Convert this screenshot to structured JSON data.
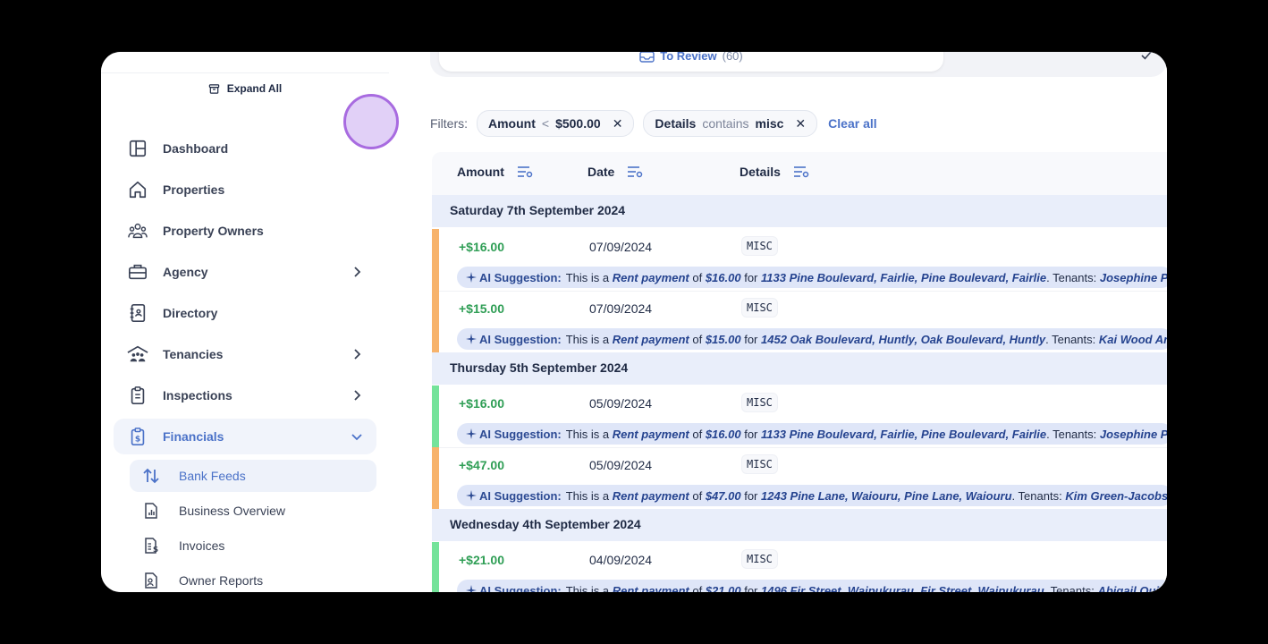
{
  "sidebar": {
    "expand_all": "Expand All",
    "items": [
      {
        "label": "Dashboard",
        "icon": "dashboard-icon"
      },
      {
        "label": "Properties",
        "icon": "home-icon"
      },
      {
        "label": "Property Owners",
        "icon": "people-icon"
      },
      {
        "label": "Agency",
        "icon": "briefcase-icon"
      },
      {
        "label": "Directory",
        "icon": "contacts-book-icon"
      },
      {
        "label": "Tenancies",
        "icon": "tenants-icon"
      },
      {
        "label": "Inspections",
        "icon": "clipboard-icon"
      },
      {
        "label": "Financials",
        "icon": "money-clipboard-icon"
      }
    ],
    "sub_items": [
      {
        "label": "Bank Feeds",
        "icon": "arrows-updown-icon"
      },
      {
        "label": "Business Overview",
        "icon": "report-chart-icon"
      },
      {
        "label": "Invoices",
        "icon": "invoice-icon"
      },
      {
        "label": "Owner Reports",
        "icon": "owner-report-icon"
      }
    ]
  },
  "tabs": {
    "review_label": "To Review",
    "review_count": "(60)"
  },
  "filters": {
    "label": "Filters:",
    "chips": [
      {
        "key": "Amount",
        "op": "<",
        "value": "$500.00"
      },
      {
        "key": "Details",
        "op": "contains",
        "value": "misc"
      }
    ],
    "clear_all": "Clear all"
  },
  "table": {
    "columns": [
      "Amount",
      "Date",
      "Details"
    ],
    "groups": [
      {
        "label": "Saturday 7th September 2024",
        "rows": [
          {
            "amount": "+$16.00",
            "date": "07/09/2024",
            "details": "MISC",
            "bar_color": "#f7b36b",
            "suggestion": {
              "prefix": "AI Suggestion:",
              "t1": "This is a",
              "type": "Rent payment",
              "t2": "of",
              "amount": "$16.00",
              "t3": "for",
              "address": "1133 Pine Boulevard, Fairlie, Pine Boulevard, Fairlie",
              "t4": ". Tenants:",
              "tenants": "Josephine Price Be"
            }
          },
          {
            "amount": "+$15.00",
            "date": "07/09/2024",
            "details": "MISC",
            "bar_color": "#f7b36b",
            "suggestion": {
              "prefix": "AI Suggestion:",
              "t1": "This is a",
              "type": "Rent payment",
              "t2": "of",
              "amount": "$15.00",
              "t3": "for",
              "address": "1452 Oak Boulevard, Huntly, Oak Boulevard, Huntly",
              "t4": ". Tenants:",
              "tenants": "Kai Wood Arahan"
            }
          }
        ]
      },
      {
        "label": "Thursday 5th September 2024",
        "rows": [
          {
            "amount": "+$16.00",
            "date": "05/09/2024",
            "details": "MISC",
            "bar_color": "#74e39a",
            "suggestion": {
              "prefix": "AI Suggestion:",
              "t1": "This is a",
              "type": "Rent payment",
              "t2": "of",
              "amount": "$16.00",
              "t3": "for",
              "address": "1133 Pine Boulevard, Fairlie, Pine Boulevard, Fairlie",
              "t4": ". Tenants:",
              "tenants": "Josephine Price Be"
            }
          },
          {
            "amount": "+$47.00",
            "date": "05/09/2024",
            "details": "MISC",
            "bar_color": "#f7b36b",
            "suggestion": {
              "prefix": "AI Suggestion:",
              "t1": "This is a",
              "type": "Rent payment",
              "t2": "of",
              "amount": "$47.00",
              "t3": "for",
              "address": "1243 Pine Lane, Waiouru, Pine Lane, Waiouru",
              "t4": ". Tenants:",
              "tenants": "Kim Green-Jacobson, D"
            }
          }
        ]
      },
      {
        "label": "Wednesday 4th September 2024",
        "rows": [
          {
            "amount": "+$21.00",
            "date": "04/09/2024",
            "details": "MISC",
            "bar_color": "#74e39a",
            "suggestion": {
              "prefix": "AI Suggestion:",
              "t1": "This is a",
              "type": "Rent payment",
              "t2": "of",
              "amount": "$21.00",
              "t3": "for",
              "address": "1496 Fir Street, Waipukurau, Fir Street, Waipukurau",
              "t4": ". Tenants:",
              "tenants": "Abigail Quinn-J"
            }
          }
        ]
      }
    ]
  }
}
